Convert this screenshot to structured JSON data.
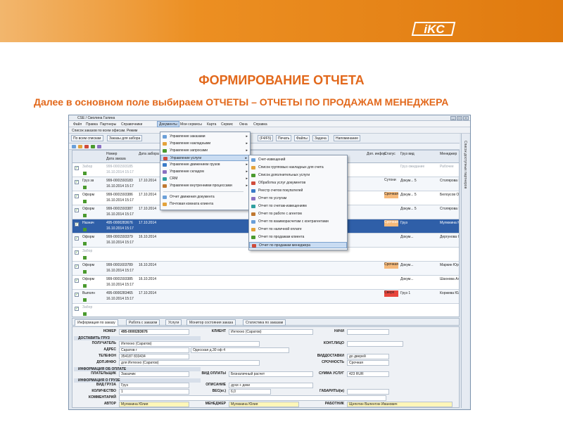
{
  "logo": {
    "text": "iKC"
  },
  "slide": {
    "title": "ФОРМИРОВАНИЕ ОТЧЕТА",
    "subtitle": "Далее в основном поле выбираем ОТЧЕТЫ – ОТЧЕТЫ ПО ПРОДАЖАМ МЕНЕДЖЕРА"
  },
  "app": {
    "window_title": "CSE / Смолина Галина",
    "menu": [
      "Файл",
      "Правка",
      "Партнеры",
      "Справочники",
      "Документы",
      "Мои сервисы",
      "Карта",
      "Сервис",
      "Окна",
      "Справка"
    ],
    "subtitle": "Список заказов по всем офисам. Режим",
    "toolbar": {
      "btn1": "По всем спискам",
      "btn2": "Заказы для забора",
      "btn3": "(F4/F5)",
      "print": "Печать",
      "files": "Файлы",
      "task": "Задача",
      "remind": "Напоминание"
    },
    "columns": {
      "number": "Номер",
      "order_date": "Дата заказа",
      "date2": "Дата забора",
      "extra": "Доп. инфор.",
      "status": "Статус",
      "cargo": "Груз вид",
      "manager": "Менеджер"
    },
    "rows": [
      {
        "col1": "Забор",
        "num": "999-0001593185",
        "d1": "16.10.2014 15:17",
        "d2": "",
        "status": "",
        "cargo": "Груз ожидание",
        "mgr": "Рабочее",
        "st": "dis"
      },
      {
        "col1": "Груз за",
        "num": "999-0001593183",
        "d1": "16.10.2014 15:17",
        "d2": "17.10.2014",
        "status": "Сутони",
        "cargo": "Докум... 5",
        "mgr": "Столярова Н",
        "st": "odd"
      },
      {
        "col1": "Оформ",
        "num": "999-0001593386",
        "d1": "16.10.2014 15:17",
        "d2": "17.10.2014",
        "status": "Срочная",
        "cargo": "Докум... 5",
        "mgr": "Белоусов Ол",
        "st": "even"
      },
      {
        "col1": "Оформ",
        "num": "999-0001593387",
        "d1": "16.10.2014 15:17",
        "d2": "17.10.2014",
        "status": "",
        "cargo": "Докум... 5",
        "mgr": "Столярова Н",
        "st": "odd"
      },
      {
        "col1": "Назнач",
        "num": "495-0000283676",
        "d1": "16.10.2014 15:17",
        "d2": "17.10.2014",
        "status": "Срочная",
        "cargo": "Груз",
        "mgr": "Мулюкина Юли",
        "st": "sel"
      },
      {
        "col1": "Оформ",
        "num": "999-0001593379",
        "d1": "16.10.2014 15:17",
        "d2": "16.10.2014",
        "status": "",
        "cargo": "Докум...",
        "mgr": "Дергунова Св",
        "st": "odd"
      },
      {
        "col1": "Забор",
        "num": "",
        "d1": "",
        "d2": "",
        "status": "",
        "cargo": "",
        "mgr": "",
        "st": "dis"
      },
      {
        "col1": "Оформ",
        "num": "999-0001603789",
        "d1": "16.10.2014 15:17",
        "d2": "16.10.2014",
        "status": "Срочная",
        "cargo": "Докум...",
        "mgr": "Маркин Юри",
        "st": "odd"
      },
      {
        "col1": "Оформ",
        "num": "999-0001593385",
        "d1": "16.10.2014 15:17",
        "d2": "16.10.2014",
        "status": "",
        "cargo": "Докум...",
        "mgr": "Шахнова Ал",
        "st": "even"
      },
      {
        "col1": "Выполн",
        "num": "495-0000283465",
        "d1": "16.10.2014 15:17",
        "d2": "17.10.2014",
        "status": "Сверх",
        "cargo": "Груз 1",
        "mgr": "Коржева Юл",
        "st": "odd"
      },
      {
        "col1": "Забор",
        "num": "",
        "d1": "",
        "d2": "",
        "status": "",
        "cargo": "",
        "mgr": "",
        "st": "dis"
      }
    ],
    "menu_documents": [
      "Управление заказами",
      "Управление накладными",
      "Управление запросами",
      "Управление услуги",
      "Управление движением грузов",
      "Управление складом",
      "CRM",
      "Управление внутренними процессами",
      "Отчет движения документа",
      "Почтовая комната клиента"
    ],
    "menu_reports": [
      "Счет-извещений",
      "Список групповых накладных для счета",
      "Список дополнительных услуги",
      "Обработка услуг документов",
      "Реестр счетов покупателей",
      "Отчет по услугам",
      "Отчет по счетам-извещениям",
      "Отчет по работе с агентом",
      "Отчет по взаиморасчетам с контрагентами",
      "Отчет по наличной оплате",
      "Отчет по продажам клиента",
      "Отчет по продажам менеджера"
    ],
    "panel_tabs": [
      "Информация по заказу",
      "Работа с заказом",
      "Услуги",
      "Монитор состояния заказа",
      "Статистика по заказам"
    ],
    "form": {
      "number_label": "НОМЕР",
      "number": "495-0000283676",
      "client_label": "КЛИЕНТ",
      "client": "Интехно (Саратов)",
      "nachi_label": "НАЧИ",
      "sec_delivery": "ДОСТАВИТЬ ГРУЗ",
      "recipient_label": "ПОЛУЧАТЕЛЬ",
      "recipient": "Интехно (Саратов)",
      "contact_label": "КОНТ.ЛИЦО",
      "address_label": "АДРЕС",
      "city": "Саратов г",
      "street": "Одесская д.30 оф 4",
      "phone_label": "ТЕЛЕФОН",
      "phone": "354187 833434",
      "deliv_type_label": "ВИДДОСТАВКИ",
      "deliv_type": "до дверей",
      "add_info_label": "ДОП.ИНФО",
      "add_info": "для Интехно (Саратов)",
      "urgency_label": "СРОЧНОСТЬ",
      "urgency": "Срочная",
      "sec_payment": "ИНФОРМАЦИЯ ОБ ОПЛАТЕ",
      "payer_label": "ПЛАТЕЛЬЩИК",
      "payer": "Заказчик",
      "payment_type_label": "ВИД ОПЛАТЫ",
      "payment_type": "Безналичный расчет",
      "sum_label": "СУММА УСЛУГ",
      "sum": "423 RUR",
      "sec_cargo": "ИНФОРМАЦИЯ О ГРУЗЕ",
      "cargo_type_label": "ВИД ГРУЗА",
      "cargo_type": "Груз",
      "desc_label": "ОПИСАНИЕ",
      "desc": "духи + деки",
      "qty_label": "КОЛИЧЕСТВО",
      "qty": "1",
      "weight_label": "ВЕС(кг.)",
      "weight": "6,0",
      "dims_label": "ГАБАРИТЫ(м)",
      "comment_label": "КОММЕНТАРИЙ",
      "author_label": "АВТОР",
      "author": "Мулюкина Юлия",
      "manager_label": "МЕНЕДЖЕР",
      "manager": "Мулюкина Юлия",
      "worker_label": "РАБОТНИК",
      "worker": "Щепотин Валентин Иванович"
    },
    "sidebar_vertical": "Список доступных партнеров"
  }
}
